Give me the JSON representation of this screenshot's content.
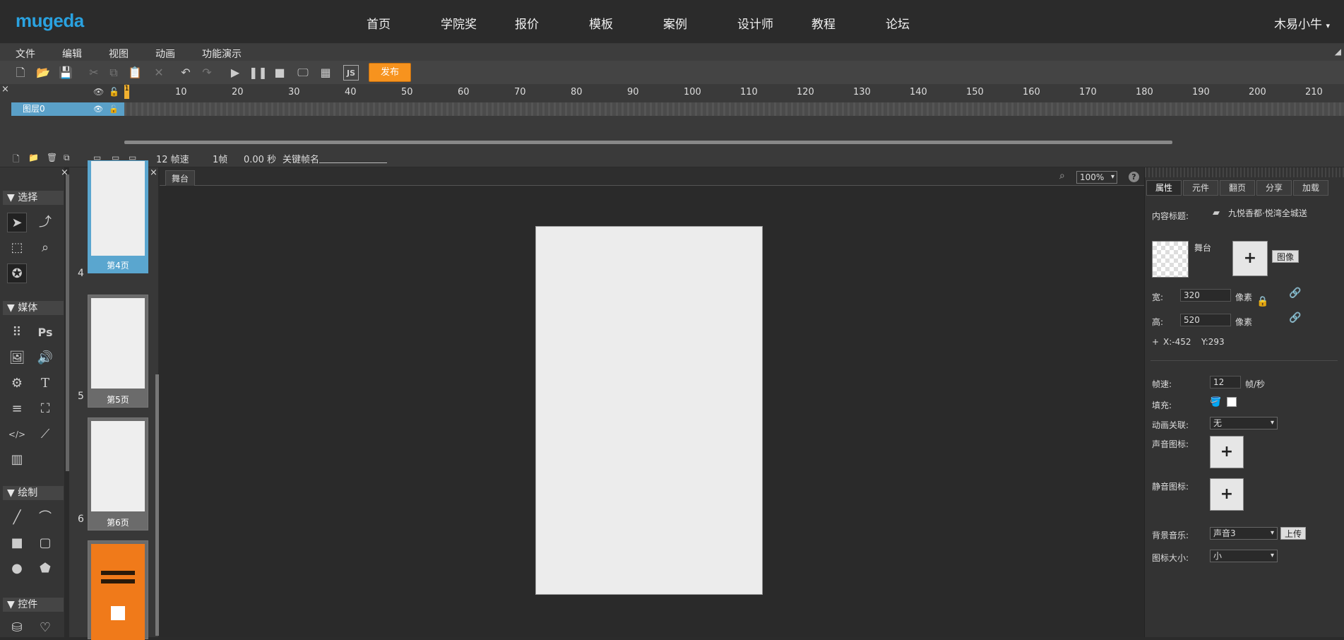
{
  "topnav": {
    "logo": "mugeda",
    "items": [
      "首页",
      "学院奖",
      "报价",
      "模板",
      "案例",
      "设计师",
      "教程",
      "论坛"
    ],
    "user": "木易小牛"
  },
  "menubar": {
    "items": [
      "文件",
      "编辑",
      "视图",
      "动画",
      "功能演示"
    ]
  },
  "toolbar": {
    "publish_label": "发布"
  },
  "timeline": {
    "ruler_ticks": [
      "10",
      "20",
      "30",
      "40",
      "50",
      "60",
      "70",
      "80",
      "90",
      "100",
      "110",
      "120",
      "130",
      "140",
      "150",
      "160",
      "170",
      "180",
      "190",
      "200",
      "210"
    ],
    "layer_name": "图层0",
    "current_frame_marker": "1",
    "status": {
      "fps": "12 帧速",
      "frame": "1帧",
      "time": "0.00 秒",
      "keyframe_label": "关键帧名"
    }
  },
  "tools": {
    "sections": [
      "选择",
      "媒体",
      "绘制",
      "控件"
    ]
  },
  "pages": [
    {
      "num": "4",
      "label": "第4页",
      "selected": true
    },
    {
      "num": "5",
      "label": "第5页",
      "selected": false
    },
    {
      "num": "6",
      "label": "第6页",
      "selected": false
    }
  ],
  "stage": {
    "tab": "舞台",
    "zoom": "100%",
    "help": "?"
  },
  "props": {
    "tabs": [
      "属性",
      "元件",
      "翻页",
      "分享",
      "加载"
    ],
    "content_title_label": "内容标题:",
    "content_title_value": "九悦香都·悦湾全城送",
    "stage_label": "舞台",
    "image_button": "图像",
    "width_label": "宽:",
    "width_value": "320",
    "height_label": "高:",
    "height_value": "520",
    "unit": "像素",
    "coords_x": "X:-452",
    "coords_y": "Y:293",
    "coords_plus": "+",
    "fps_label": "帧速:",
    "fps_value": "12",
    "fps_unit": "帧/秒",
    "fill_label": "填充:",
    "anim_link_label": "动画关联:",
    "anim_link_value": "无",
    "sound_icon_label": "声音图标:",
    "mute_icon_label": "静音图标:",
    "bg_music_label": "背景音乐:",
    "bg_music_value": "声音3",
    "upload_button": "上传",
    "icon_size_label": "图标大小:",
    "icon_size_value": "小"
  }
}
